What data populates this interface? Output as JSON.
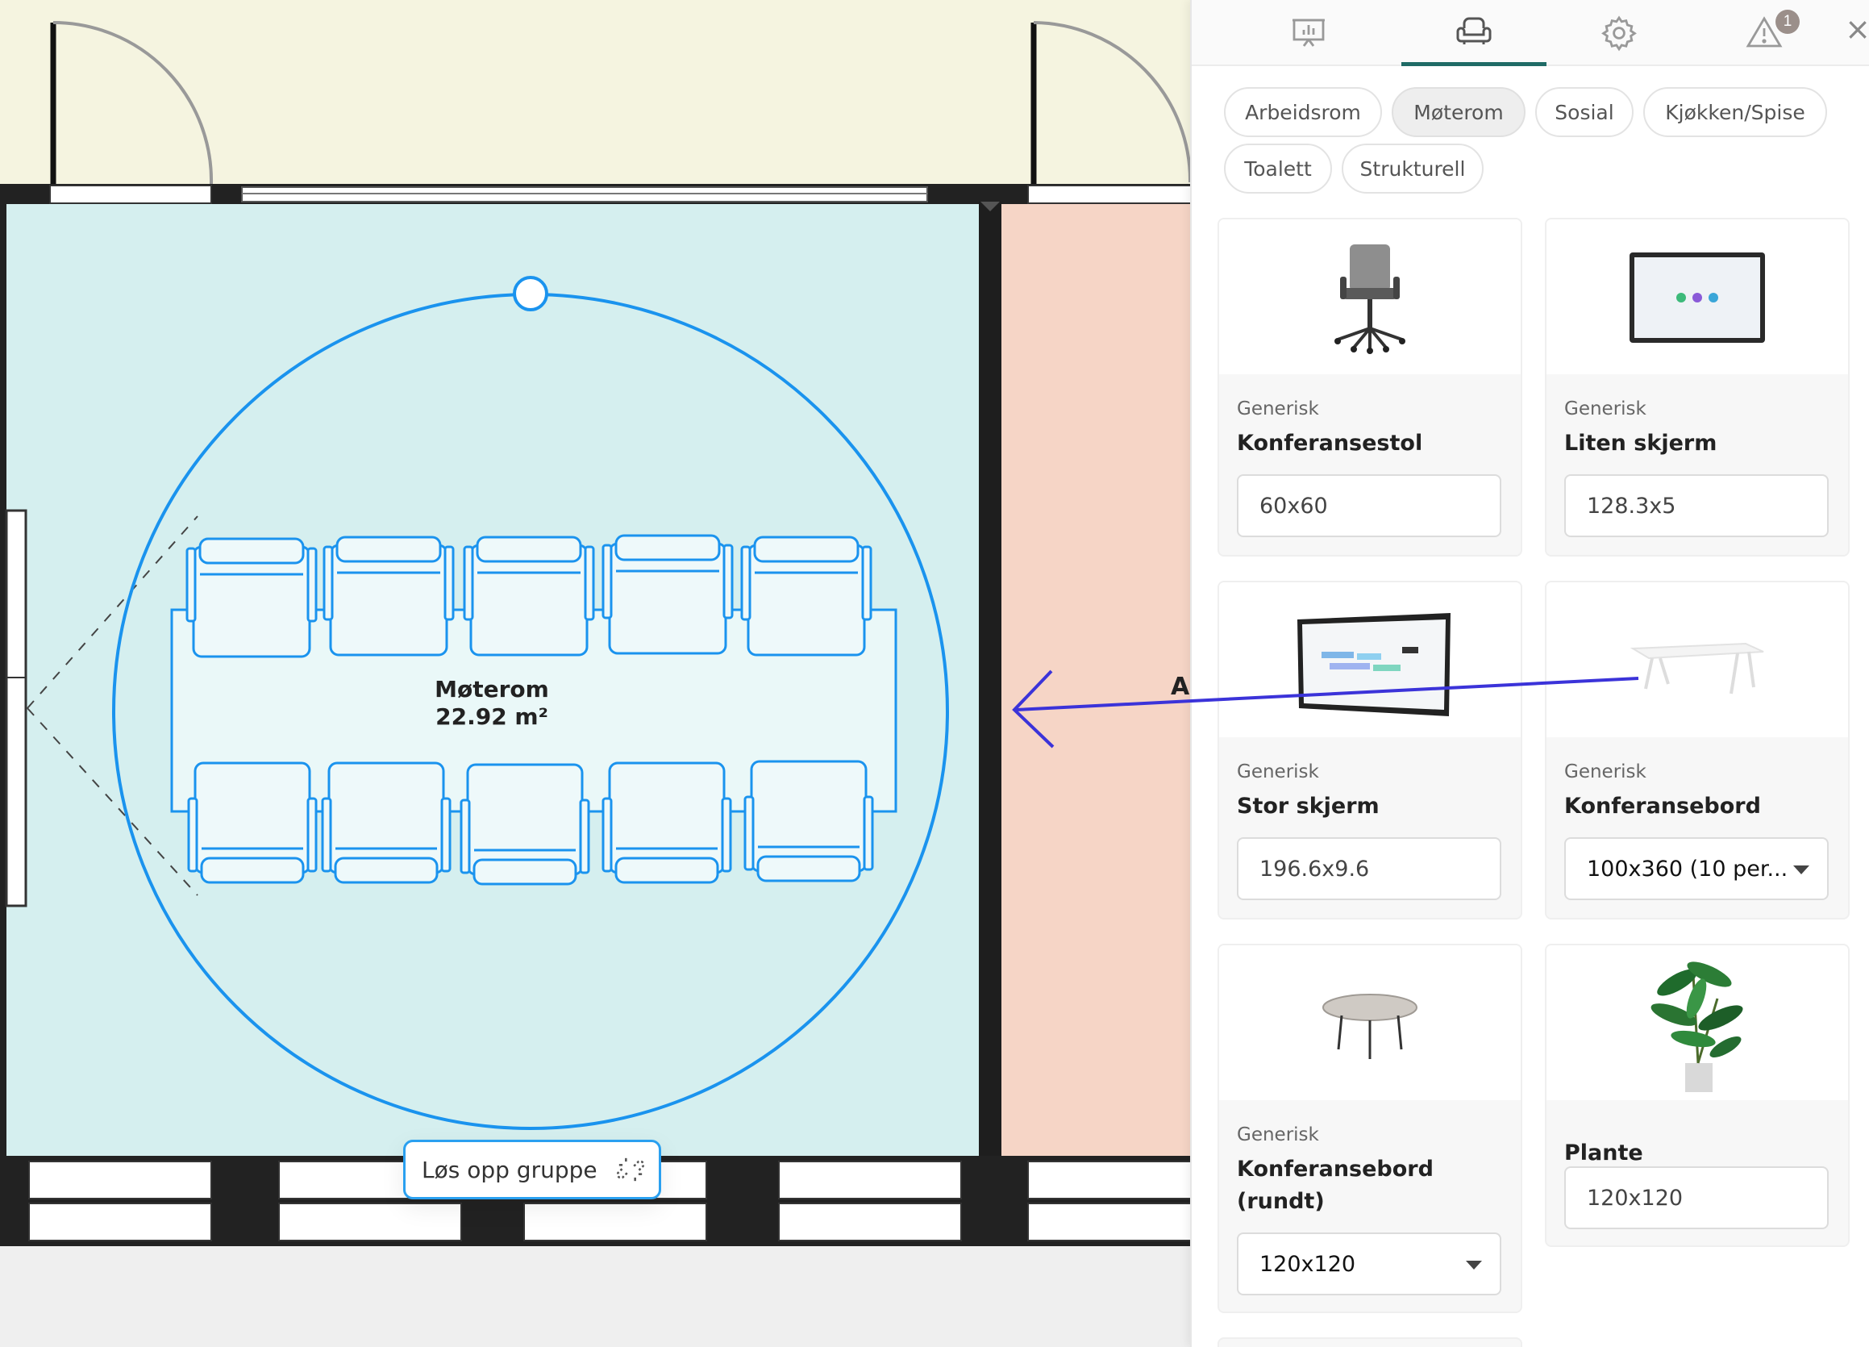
{
  "toolbar_tabs": [
    {
      "name": "presentation",
      "icon": "presentation-icon",
      "active": false
    },
    {
      "name": "furniture",
      "icon": "armchair-icon",
      "active": true
    },
    {
      "name": "settings",
      "icon": "gear-icon",
      "active": false
    },
    {
      "name": "warnings",
      "icon": "warning-icon",
      "active": false,
      "badge": "1"
    }
  ],
  "categories": [
    {
      "label": "Arbeidsrom",
      "active": false
    },
    {
      "label": "Møterom",
      "active": true
    },
    {
      "label": "Sosial",
      "active": false
    },
    {
      "label": "Kjøkken/Spise",
      "active": false
    },
    {
      "label": "Toalett",
      "active": false
    },
    {
      "label": "Strukturell",
      "active": false
    }
  ],
  "products": [
    {
      "brand": "Generisk",
      "title": "Konferansestol",
      "size": "60x60",
      "control": "input",
      "image": "office-chair"
    },
    {
      "brand": "Generisk",
      "title": "Liten skjerm",
      "size": "128.3x5",
      "control": "input",
      "image": "small-screen"
    },
    {
      "brand": "Generisk",
      "title": "Stor skjerm",
      "size": "196.6x9.6",
      "control": "input",
      "image": "large-screen"
    },
    {
      "brand": "Generisk",
      "title": "Konferansebord",
      "size": "100x360 (10 per...",
      "control": "select",
      "image": "conference-table"
    },
    {
      "brand": "Generisk",
      "title": "Konferansebord (rundt)",
      "size": "120x120",
      "control": "select",
      "image": "round-table"
    },
    {
      "brand": "",
      "title": "Plante",
      "size": "120x120",
      "control": "input",
      "image": "plant"
    }
  ],
  "room": {
    "name": "Møterom",
    "area": "22.92 m²"
  },
  "neighbor_room_label": "Ar",
  "ungroup_button": {
    "label": "Løs opp gruppe",
    "icon": "unlink-icon"
  },
  "colors": {
    "room_fill": "#d5efef",
    "neighbor_fill": "#f6d5c6",
    "corridor_fill": "#f5f4e0",
    "selection_blue": "#1a93ee",
    "drag_arrow": "#3b33d9",
    "active_tab_underline": "#1f6b66"
  }
}
